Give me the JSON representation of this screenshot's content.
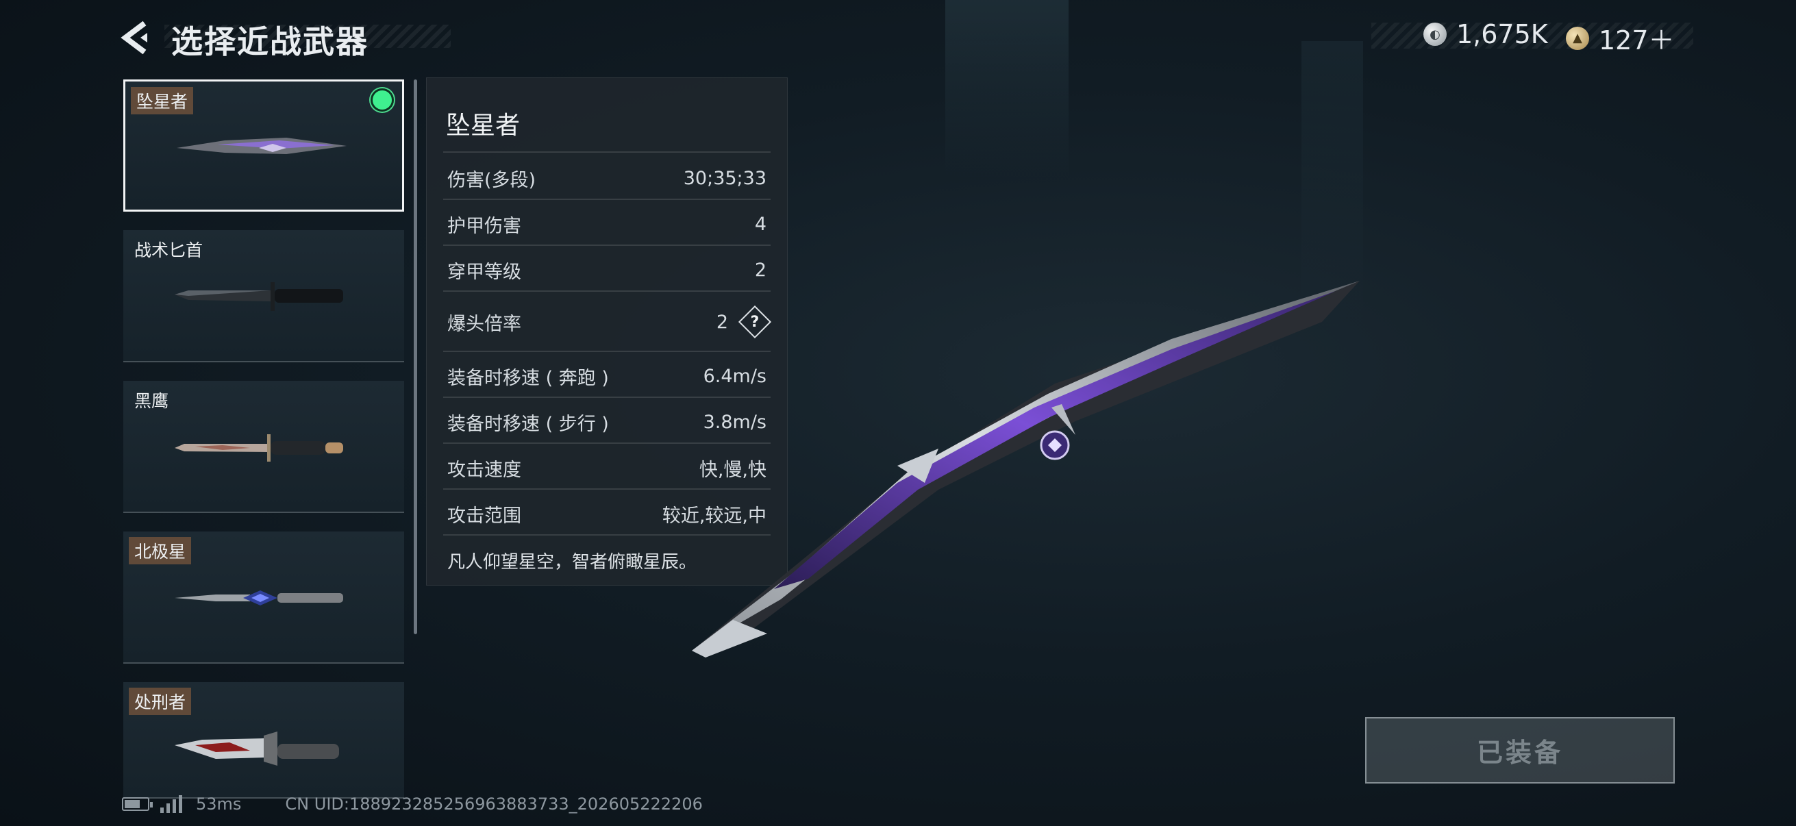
{
  "header": {
    "title": "选择近战武器",
    "back_icon": "back-chevron-icon"
  },
  "currency": [
    {
      "icon": "silver-coin-icon",
      "value": "1,675K"
    },
    {
      "icon": "gold-badge-icon",
      "value": "127＋"
    }
  ],
  "weapons": [
    {
      "name": "坠星者",
      "selected": true,
      "equipped": true,
      "name_tag": true
    },
    {
      "name": "战术匕首",
      "selected": false,
      "equipped": false,
      "name_tag": false
    },
    {
      "name": "黑鹰",
      "selected": false,
      "equipped": false,
      "name_tag": false
    },
    {
      "name": "北极星",
      "selected": false,
      "equipped": false,
      "name_tag": true
    },
    {
      "name": "处刑者",
      "selected": false,
      "equipped": false,
      "name_tag": true
    }
  ],
  "details": {
    "name": "坠星者",
    "stats": [
      {
        "label": "伤害(多段)",
        "value": "30;35;33"
      },
      {
        "label": "护甲伤害",
        "value": "4"
      },
      {
        "label": "穿甲等级",
        "value": "2"
      },
      {
        "label": "爆头倍率",
        "value": "2",
        "help_icon": "question-icon"
      },
      {
        "label": "装备时移速 ( 奔跑 )",
        "value": "6.4m/s"
      },
      {
        "label": "装备时移速 ( 步行 )",
        "value": "3.8m/s"
      },
      {
        "label": "攻击速度",
        "value": "快,慢,快"
      },
      {
        "label": "攻击范围",
        "value": "较近,较远,中"
      }
    ],
    "description": "凡人仰望星空，智者俯瞰星辰。"
  },
  "equip_button": {
    "label": "已装备",
    "enabled": false
  },
  "status_bar": {
    "ping": "53ms",
    "uid": "CN UID:188923285256963883733_202605222206"
  },
  "colors": {
    "selected_dot": "#3ff08f",
    "name_tag_bg": "#78563c",
    "accent_purple": "#7b4fd6"
  }
}
